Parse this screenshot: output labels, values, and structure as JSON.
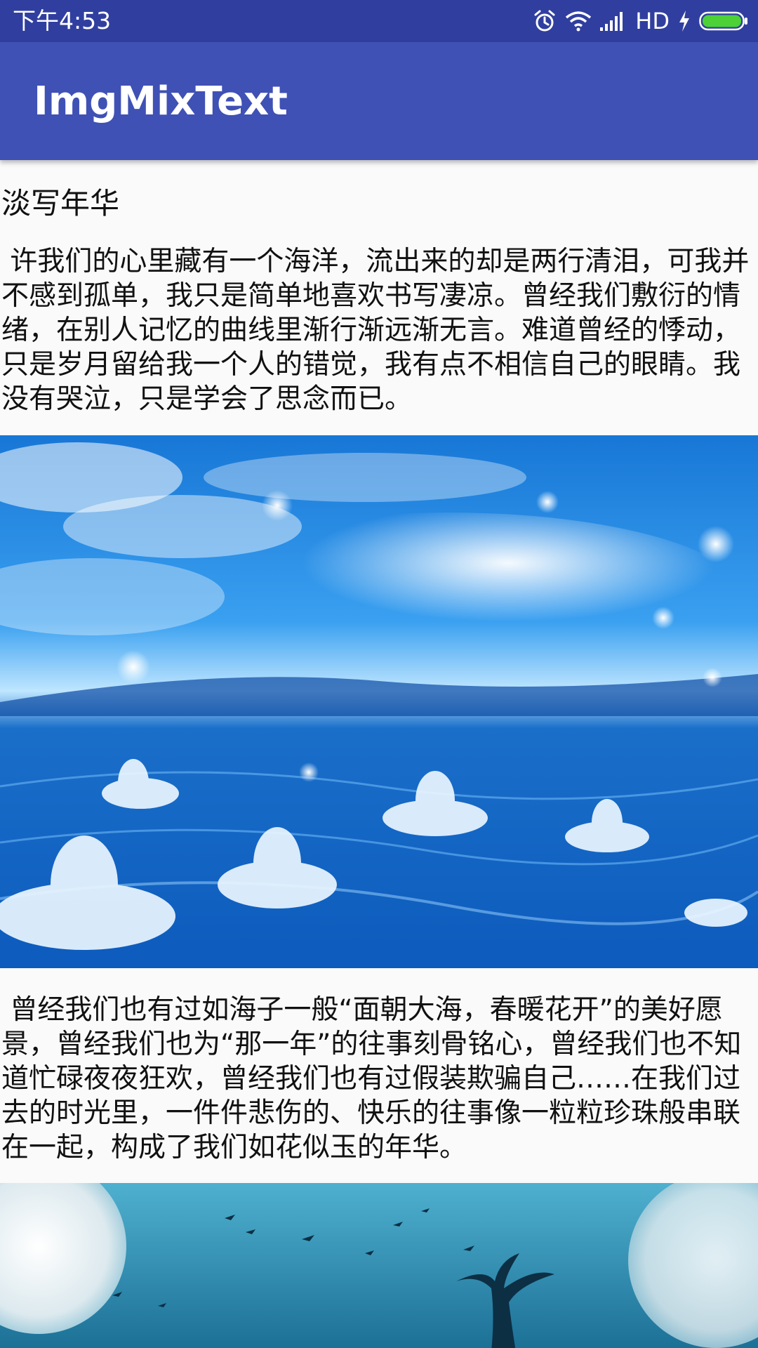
{
  "status_bar": {
    "time": "下午4:53",
    "network": "HD",
    "icons": [
      "alarm-icon",
      "wifi-icon",
      "signal-icon",
      "charging-icon",
      "battery-icon"
    ]
  },
  "app_bar": {
    "title": "ImgMixText"
  },
  "article": {
    "title": "淡写年华",
    "paragraphs": [
      " 许我们的心里藏有一个海洋，流出来的却是两行清泪，可我并不感到孤单，我只是简单地喜欢书写凄凉。曾经我们敷衍的情绪，在别人记忆的曲线里渐行渐远渐无言。难道曾经的悸动，只是岁月留给我一个人的错觉，我有点不相信自己的眼睛。我没有哭泣，只是学会了思念而已。",
      " 曾经我们也有过如海子一般“面朝大海，春暖花开”的美好愿景，曾经我们也为“那一年”的往事刻骨铭心，曾经我们也不知道忙碌夜夜狂欢，曾经我们也有过假装欺骗自己……在我们过去的时光里，一件件悲伤的、快乐的往事像一粒粒珍珠般串联在一起，构成了我们如花似玉的年华。"
    ],
    "images": [
      "blue-lotus-sea-image",
      "moonlit-tree-image"
    ]
  },
  "colors": {
    "status_bar": "#303f9f",
    "app_bar": "#3f51b5",
    "background": "#fafafa",
    "text": "#111111"
  }
}
